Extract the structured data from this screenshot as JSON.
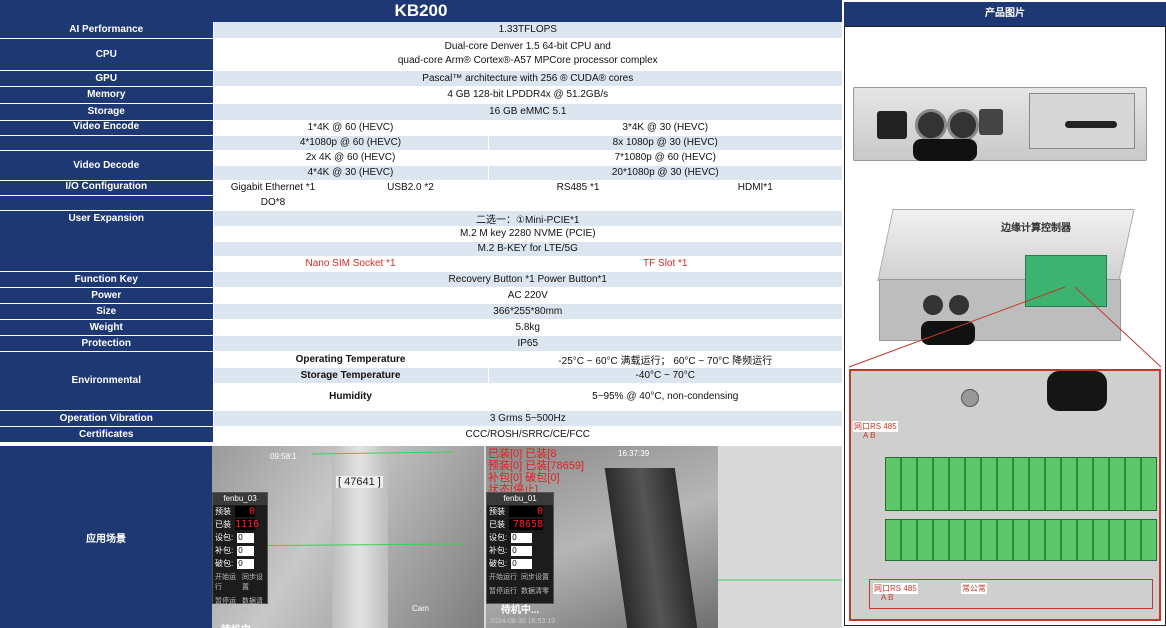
{
  "title": "KB200",
  "photo_header": "产品图片",
  "scene_label": "应用场景",
  "specs": {
    "ai_label": "AI Performance",
    "ai_value": "1.33TFLOPS",
    "cpu_label": "CPU",
    "cpu_line1": "Dual-core Denver 1.5 64-bit CPU and",
    "cpu_line2": "quad-core Arm® Cortex®-A57 MPCore processor complex",
    "gpu_label": "GPU",
    "gpu_value": "Pascal™ architecture with 256 ® CUDA® cores",
    "mem_label": "Memory",
    "mem_value": "4 GB 128-bit LPDDR4x @ 51.2GB/s",
    "storage_label": "Storage",
    "storage_value": "16 GB eMMC 5.1",
    "enc_label": "Video Encode",
    "enc_r1c1": "1*4K @ 60 (HEVC)",
    "enc_r1c2": "3*4K @ 30 (HEVC)",
    "enc_r2c1": "4*1080p @ 60 (HEVC)",
    "enc_r2c2": "8x 1080p @ 30 (HEVC)",
    "dec_label": "Video Decode",
    "dec_r1c1": "2x 4K @ 60 (HEVC)",
    "dec_r1c2": "7*1080p @ 60 (HEVC)",
    "dec_r2c1": "4*4K @ 30 (HEVC)",
    "dec_r2c2": "20*1080p @ 30 (HEVC)",
    "io_label": "I/O Configuration",
    "io_c1": "Gigabit Ethernet *1",
    "io_c2": "USB2.0 *2",
    "io_c3": "RS485 *1",
    "io_c4": "HDMI*1",
    "io_do": "DO*8",
    "ue_label": "User Expansion",
    "ue_r1": "二选一：①Mini-PCIE*1",
    "ue_r2": "M.2 M key 2280 NVME   (PCIE)",
    "ue_r3": "M.2 B-KEY for LTE/5G",
    "ue_sim": "Nano SIM Socket *1",
    "ue_tf": "TF Slot *1",
    "fk_label": "Function Key",
    "fk_value": "Recovery Button *1 Power Button*1",
    "power_label": "Power",
    "power_value": "AC 220V",
    "size_label": "Size",
    "size_value": "366*255*80mm",
    "weight_label": "Weight",
    "weight_value": "5.8kg",
    "prot_label": "Protection",
    "prot_value": "IP65",
    "env_label": "Environmental",
    "op_temp_label": "Operating Temperature",
    "op_temp_value": "-25°C ~ 60°C 满载运行；  60°C ~ 70°C 降频运行",
    "st_temp_label": "Storage Temperature",
    "st_temp_value": "-40°C ~ 70°C",
    "hum_label": "Humidity",
    "hum_value": "5~95% @ 40°C, non-condensing",
    "vib_label": "Operation Vibration",
    "vib_value": "3 Grms 5~500Hz",
    "cert_label": "Certificates",
    "cert_value": "CCC/ROSH/SRRC/CE/FCC"
  },
  "scene": {
    "cam1_tag": "[ 47641 ]",
    "cam1_time": "09:58:1",
    "cam1_tool": "Cam",
    "cam1_ctrl": {
      "title": "fenbu_03",
      "rows": [
        "预装",
        "已装",
        "设包:",
        "补包:",
        "破包:"
      ],
      "preset": "0",
      "loaded": "1116",
      "f1": "0",
      "f2": "0",
      "f3": "0",
      "btn1": "开始运行",
      "btn2": "同步设置",
      "btn3": "暂停运行",
      "btn4": "数据清零",
      "status": "待机中..."
    },
    "cam2_ovl1": "已装[0] 已装[8",
    "cam2_ovl2": "预装[0] 已装[78659]",
    "cam2_ovl3": "补包[0] 破包[0]",
    "cam2_ovl4": "状态[停止]",
    "cam2_time": "16:37:39",
    "cam2_date": "2024-08-30 16:53:19",
    "cam2_ctrl": {
      "title": "fenbu_01",
      "rows": [
        "预装",
        "已装",
        "设包:",
        "补包:",
        "破包:"
      ],
      "preset": "0",
      "loaded": "78658",
      "f1": "0",
      "f2": "0",
      "f3": "0",
      "btn1": "开始运行",
      "btn2": "同步设置",
      "btn3": "暂停运行",
      "btn4": "数据清零",
      "status": "待机中..."
    }
  },
  "photo": {
    "device_label": "边缘计算控制器",
    "terminal_top_left": "网口RS 485",
    "terminal_top_ab": "A    B",
    "terminal_mark": "常公常",
    "terminal_bottom_left": "网口RS 485",
    "terminal_bottom_ab": "A    B"
  }
}
